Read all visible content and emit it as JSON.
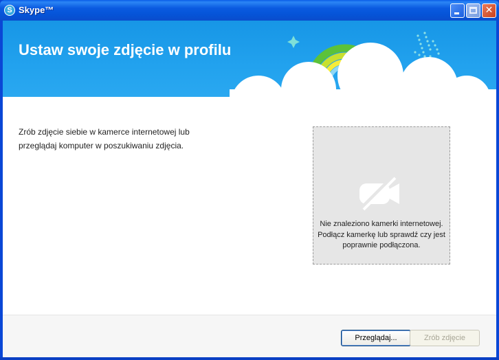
{
  "window": {
    "title": "Skype™",
    "icon": "skype-logo-icon",
    "controls": [
      "minimize-icon",
      "maximize-icon",
      "close-icon"
    ]
  },
  "banner": {
    "heading": "Ustaw swoje zdjęcie w profilu"
  },
  "main": {
    "instruction": "Zrób zdjęcie siebie w kamerce internetowej lub przeglądaj komputer w poszukiwaniu zdjęcia."
  },
  "camera": {
    "icon": "camera-off-icon",
    "message": "Nie znaleziono kamerki internetowej. Podłącz kamerkę lub sprawdź czy jest poprawnie podłączona."
  },
  "buttons": {
    "browse": "Przeglądaj...",
    "take_photo": "Zrób zdjęcie",
    "take_photo_enabled": false
  },
  "colors": {
    "banner": "#1e9cea",
    "titlebar": "#0a5ae0",
    "camera_panel": "#e6e6e6"
  }
}
